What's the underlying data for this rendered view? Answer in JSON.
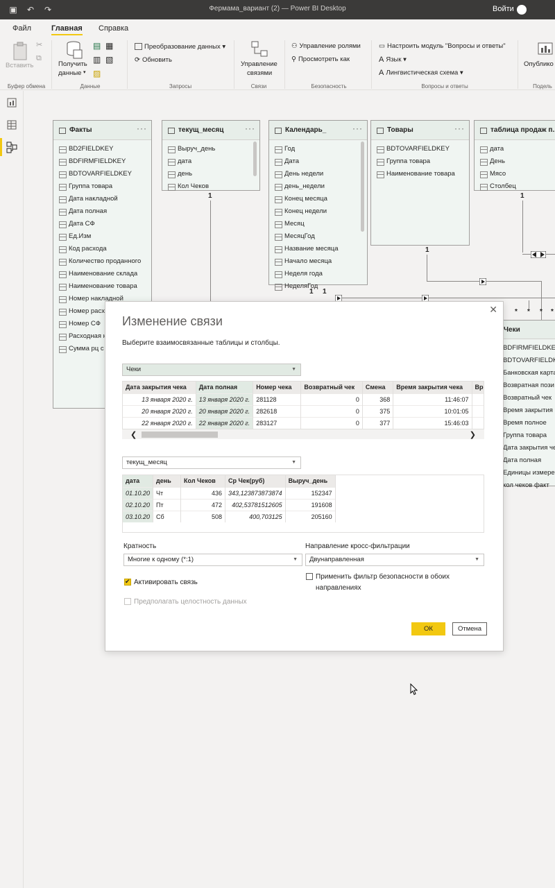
{
  "window": {
    "title": "Фермама_вариант (2) — Power BI Desktop",
    "signin": "Войти"
  },
  "tabs": [
    "Файл",
    "Главная",
    "Справка"
  ],
  "ribbon": {
    "clipboard": {
      "paste": "Вставить",
      "group": "Буфер обмена"
    },
    "data": {
      "get_data_line1": "Получить",
      "get_data_line2": "данные",
      "group": "Данные"
    },
    "queries": {
      "transform": "Преобразование данных",
      "refresh": "Обновить",
      "group": "Запросы"
    },
    "relations": {
      "manage_line1": "Управление",
      "manage_line2": "связями",
      "group": "Связи"
    },
    "security": {
      "manage_roles": "Управление ролями",
      "view_as": "Просмотреть как",
      "group": "Безопасность"
    },
    "qa": {
      "setup": "Настроить модуль \"Вопросы и ответы\"",
      "language": "Язык",
      "linguistic": "Лингвистическая схема",
      "group": "Вопросы и ответы"
    },
    "share": {
      "publish": "Опублико",
      "group": "Подель"
    }
  },
  "tables": {
    "facts": {
      "name": "Факты",
      "fields": [
        "BD2FIELDKEY",
        "BDFIRMFIELDKEY",
        "BDTOVARFIELDKEY",
        "Группа товара",
        "Дата накладной",
        "Дата полная",
        "Дата СФ",
        "Ед.Изм",
        "Код расхода",
        "Количество проданного",
        "Наименование склада",
        "Наименование товара",
        "Номер накладной",
        "Номер расх",
        "Номер СФ",
        "Расходная н",
        "Сумма рц с"
      ]
    },
    "current_month": {
      "name": "текущ_месяц",
      "fields": [
        "Выруч_день",
        "дата",
        "день",
        "Кол Чеков"
      ],
      "cardinality": "1"
    },
    "calendar": {
      "name": "Календарь_",
      "fields": [
        "Год",
        "Дата",
        "День недели",
        "день_недели",
        "Конец месяца",
        "Конец недели",
        "Месяц",
        "МесяцГод",
        "Название месяца",
        "Начало месяца",
        "Неделя года",
        "НеделяГод"
      ],
      "cardinality": "1"
    },
    "goods": {
      "name": "Товары",
      "fields": [
        "BDTOVARFIELDKEY",
        "Группа товара",
        "Наименование товара"
      ],
      "cardinality": "1"
    },
    "sales": {
      "name": "таблица продаж п...",
      "fields": [
        "дата",
        "День",
        "Мясо",
        "Столбец"
      ],
      "cardinality": "1"
    },
    "checks": {
      "name": "Чеки",
      "fields": [
        "BDFIRMFIELDKEY",
        "BDTOVARFIELDKE",
        "Банковская карта",
        "Возвратная пози",
        "Возвратный чек",
        "Время закрытия",
        "Время полное",
        "Группа товара",
        "Дата закрытия че",
        "Дата полная",
        "Единицы измере",
        "кол чеков факт"
      ]
    }
  },
  "many_marker": "*",
  "dialog": {
    "title": "Изменение связи",
    "subtitle": "Выберите взаимосвязанные таблицы и столбцы.",
    "table1": {
      "selected": "Чеки",
      "columns": [
        "Дата закрытия чека",
        "Дата полная",
        "Номер чека",
        "Возвратный чек",
        "Смена",
        "Время закрытия чека",
        "Вре"
      ],
      "rows": [
        [
          "13 января 2020 г.",
          "13 января 2020 г.",
          "281128",
          "0",
          "368",
          "11:46:07",
          ""
        ],
        [
          "20 января 2020 г.",
          "20 января 2020 г.",
          "282618",
          "0",
          "375",
          "10:01:05",
          ""
        ],
        [
          "22 января 2020 г.",
          "22 января 2020 г.",
          "283127",
          "0",
          "377",
          "15:46:03",
          ""
        ]
      ]
    },
    "table2": {
      "selected": "текущ_месяц",
      "columns": [
        "дата",
        "день",
        "Кол Чеков",
        "Ср Чек(руб)",
        "Выруч_день"
      ],
      "rows": [
        [
          "01.10.20",
          "Чт",
          "436",
          "343,123873873874",
          "152347"
        ],
        [
          "02.10.20",
          "Пт",
          "472",
          "402,53781512605",
          "191608"
        ],
        [
          "03.10.20",
          "Сб",
          "508",
          "400,703125",
          "205160"
        ]
      ]
    },
    "cardinality": {
      "label": "Кратность",
      "value": "Многие к одному (*:1)"
    },
    "crossfilter": {
      "label": "Направление кросс-фильтрации",
      "value": "Двунаправленная"
    },
    "activate": {
      "label": "Активировать связь",
      "checked": true
    },
    "assume_integrity": {
      "label": "Предполагать целостность данных",
      "checked": false,
      "disabled": true
    },
    "security_filter": {
      "label_line1": "Применить фильтр безопасности в обоих",
      "label_line2": "направлениях",
      "checked": false
    },
    "ok": "ОК",
    "cancel": "Отмена"
  },
  "colors": {
    "accent": "#f2c811",
    "titlebar": "#3b3a39",
    "card_bg": "#f0f5f2"
  }
}
